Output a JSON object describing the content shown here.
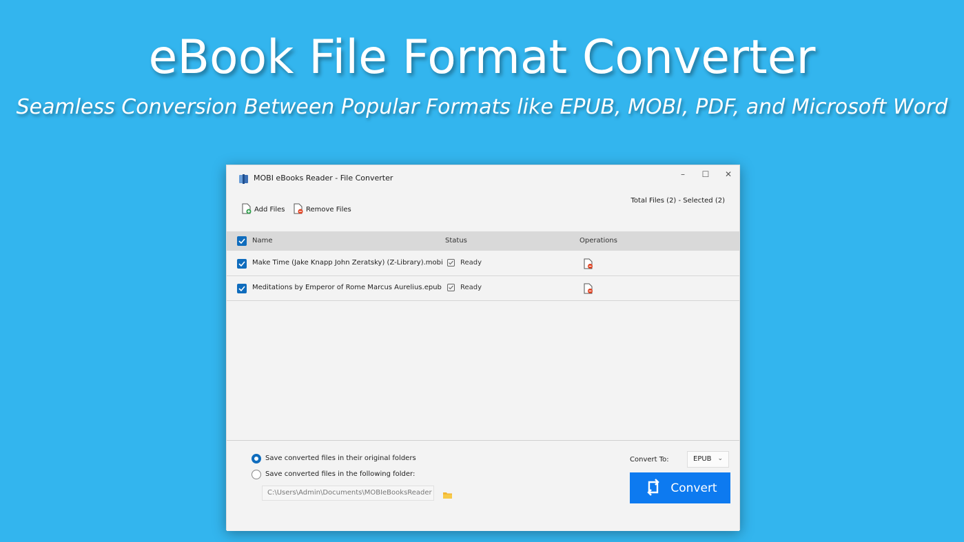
{
  "hero": {
    "title": "eBook File Format Converter",
    "subtitle": "Seamless Conversion Between Popular Formats like EPUB, MOBI, PDF, and Microsoft Word"
  },
  "window": {
    "title": "MOBI eBooks Reader - File Converter",
    "controls": {
      "minimize": "–",
      "maximize": "☐",
      "close": "✕"
    }
  },
  "toolbar": {
    "add_files": "Add Files",
    "remove_files": "Remove Files",
    "totals": "Total Files (2) - Selected (2)"
  },
  "list": {
    "columns": {
      "name": "Name",
      "status": "Status",
      "operations": "Operations"
    },
    "rows": [
      {
        "name": "Make Time (Jake Knapp  John Zeratsky) (Z-Library).mobi",
        "status": "Ready"
      },
      {
        "name": "Meditations by Emperor of Rome Marcus Aurelius.epub",
        "status": "Ready"
      }
    ]
  },
  "output": {
    "option_original": "Save converted files in their original folders",
    "option_folder": "Save converted files in the following folder:",
    "folder_path": "C:\\Users\\Admin\\Documents\\MOBIeBooksReader",
    "convert_to_label": "Convert To:",
    "format_value": "EPUB",
    "convert_button": "Convert"
  },
  "colors": {
    "background": "#33b5ee",
    "accent": "#0f6cbd",
    "convert_button": "#0d7af0"
  }
}
